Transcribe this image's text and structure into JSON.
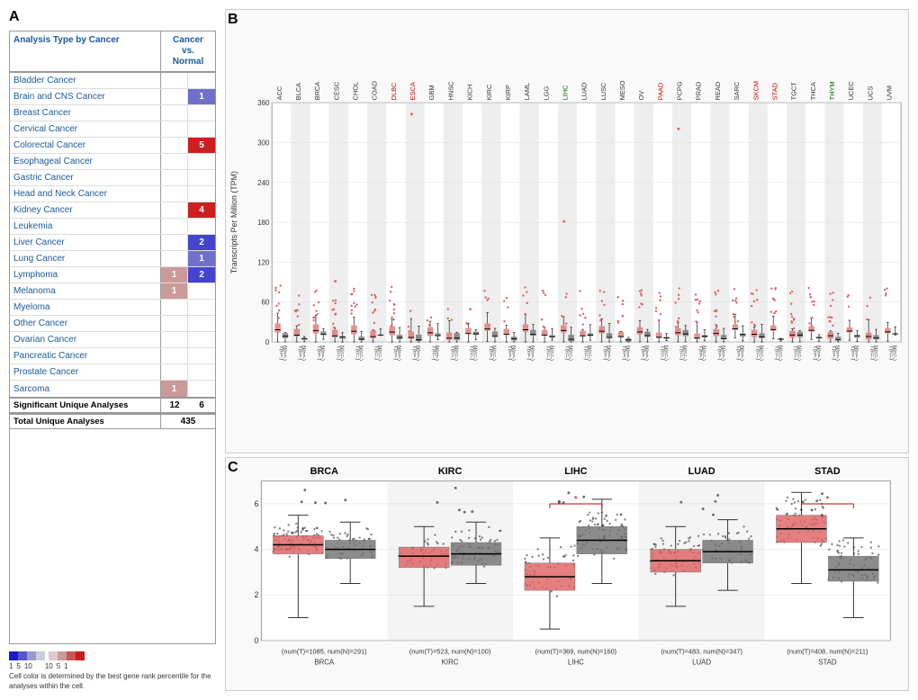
{
  "panels": {
    "a_label": "A",
    "b_label": "B",
    "c_label": "C"
  },
  "table": {
    "header_cancer": "Analysis Type by Cancer",
    "header_cnv_line1": "Cancer",
    "header_cnv_line2": "vs.",
    "header_cnv_line3": "Normal",
    "rows": [
      {
        "cancer": "Bladder Cancer",
        "val1": null,
        "val2": null,
        "col1": null,
        "col2": null
      },
      {
        "cancer": "Brain and CNS Cancer",
        "val1": null,
        "val2": "1",
        "col1": null,
        "col2": "#7070cc"
      },
      {
        "cancer": "Breast Cancer",
        "val1": null,
        "val2": null,
        "col1": null,
        "col2": null
      },
      {
        "cancer": "Cervical Cancer",
        "val1": null,
        "val2": null,
        "col1": null,
        "col2": null
      },
      {
        "cancer": "Colorectal Cancer",
        "val1": null,
        "val2": "5",
        "col1": null,
        "col2": "#cc2020"
      },
      {
        "cancer": "Esophageal Cancer",
        "val1": null,
        "val2": null,
        "col1": null,
        "col2": null
      },
      {
        "cancer": "Gastric Cancer",
        "val1": null,
        "val2": null,
        "col1": null,
        "col2": null
      },
      {
        "cancer": "Head and Neck Cancer",
        "val1": null,
        "val2": null,
        "col1": null,
        "col2": null
      },
      {
        "cancer": "Kidney Cancer",
        "val1": null,
        "val2": "4",
        "col1": null,
        "col2": "#cc2020"
      },
      {
        "cancer": "Leukemia",
        "val1": null,
        "val2": null,
        "col1": null,
        "col2": null
      },
      {
        "cancer": "Liver Cancer",
        "val1": null,
        "val2": "2",
        "col1": null,
        "col2": "#4444cc"
      },
      {
        "cancer": "Lung Cancer",
        "val1": null,
        "val2": "1",
        "col1": null,
        "col2": "#7070cc"
      },
      {
        "cancer": "Lymphoma",
        "val1": "1",
        "val2": "2",
        "col1": "#cc9999",
        "col2": "#4444cc"
      },
      {
        "cancer": "Melanoma",
        "val1": "1",
        "val2": null,
        "col1": "#cc9999",
        "col2": null
      },
      {
        "cancer": "Myeloma",
        "val1": null,
        "val2": null,
        "col1": null,
        "col2": null
      },
      {
        "cancer": "Other Cancer",
        "val1": null,
        "val2": null,
        "col1": null,
        "col2": null
      },
      {
        "cancer": "Ovarian Cancer",
        "val1": null,
        "val2": null,
        "col1": null,
        "col2": null
      },
      {
        "cancer": "Pancreatic Cancer",
        "val1": null,
        "val2": null,
        "col1": null,
        "col2": null
      },
      {
        "cancer": "Prostate Cancer",
        "val1": null,
        "val2": null,
        "col1": null,
        "col2": null
      },
      {
        "cancer": "Sarcoma",
        "val1": "1",
        "val2": null,
        "col1": "#cc9999",
        "col2": null
      }
    ],
    "footer1_label": "Significant Unique Analyses",
    "footer1_val1": "12",
    "footer1_val2": "6",
    "footer2_label": "Total Unique Analyses",
    "footer2_val": "435"
  },
  "legend": {
    "title": "Cell color is determined by the best gene rank percentile for the analyses within the cell.",
    "blue_labels": [
      "1",
      "5",
      "10"
    ],
    "red_labels": [
      "10",
      "5",
      "1"
    ],
    "blue_colors": [
      "#1a1acc",
      "#5555cc",
      "#9999cc",
      "#ccccdd"
    ],
    "red_colors": [
      "#ddcccc",
      "#cc9999",
      "#cc5555",
      "#cc1a1a"
    ]
  },
  "chart_b": {
    "ylabel": "Transcripts Per Million (TPM)",
    "yticks": [
      "360",
      "300",
      "240",
      "180",
      "120",
      "60",
      "0"
    ],
    "columns": [
      {
        "label": "ACC",
        "color": "normal"
      },
      {
        "label": "BLCA",
        "color": "normal"
      },
      {
        "label": "BRCA",
        "color": "normal"
      },
      {
        "label": "CESC",
        "color": "normal"
      },
      {
        "label": "CHOL",
        "color": "normal"
      },
      {
        "label": "COAD",
        "color": "normal"
      },
      {
        "label": "DLBC",
        "color": "red"
      },
      {
        "label": "ESCA",
        "color": "red"
      },
      {
        "label": "GBM",
        "color": "normal"
      },
      {
        "label": "HNSC",
        "color": "normal"
      },
      {
        "label": "KICH",
        "color": "normal"
      },
      {
        "label": "KIRC",
        "color": "normal"
      },
      {
        "label": "KIRP",
        "color": "normal"
      },
      {
        "label": "LAML",
        "color": "normal"
      },
      {
        "label": "LGG",
        "color": "normal"
      },
      {
        "label": "LIHC",
        "color": "green"
      },
      {
        "label": "LUAD",
        "color": "normal"
      },
      {
        "label": "LUSC",
        "color": "normal"
      },
      {
        "label": "MESO",
        "color": "normal"
      },
      {
        "label": "OV",
        "color": "normal"
      },
      {
        "label": "PAAD",
        "color": "red"
      },
      {
        "label": "PCPG",
        "color": "normal"
      },
      {
        "label": "PRAD",
        "color": "normal"
      },
      {
        "label": "READ",
        "color": "normal"
      },
      {
        "label": "SARC",
        "color": "normal"
      },
      {
        "label": "SKCM",
        "color": "red"
      },
      {
        "label": "STAD",
        "color": "red"
      },
      {
        "label": "TGCT",
        "color": "normal"
      },
      {
        "label": "THCA",
        "color": "normal"
      },
      {
        "label": "THYM",
        "color": "green"
      },
      {
        "label": "UCEC",
        "color": "normal"
      },
      {
        "label": "UCS",
        "color": "normal"
      },
      {
        "label": "UVM",
        "color": "normal"
      }
    ]
  },
  "chart_c": {
    "ylabel": "",
    "yticks": [
      "6",
      "4",
      "2",
      "0"
    ],
    "groups": [
      {
        "label": "BRCA",
        "sublabel": "(num(T)=1085, num(N)=291)",
        "tumor_median": 4.2,
        "normal_median": 4.0,
        "significant": false
      },
      {
        "label": "KIRC",
        "sublabel": "(num(T)=523, num(N)=100)",
        "tumor_median": 3.7,
        "normal_median": 3.8,
        "significant": false
      },
      {
        "label": "LIHC",
        "sublabel": "(num(T)=369, num(N)=160)",
        "tumor_median": 2.8,
        "normal_median": 4.4,
        "significant": true
      },
      {
        "label": "LUAD",
        "sublabel": "(num(T)=483, num(N)=347)",
        "tumor_median": 3.5,
        "normal_median": 3.9,
        "significant": false
      },
      {
        "label": "STAD",
        "sublabel": "(num(T)=408, num(N)=211)",
        "tumor_median": 4.9,
        "normal_median": 3.1,
        "significant": true
      }
    ]
  }
}
